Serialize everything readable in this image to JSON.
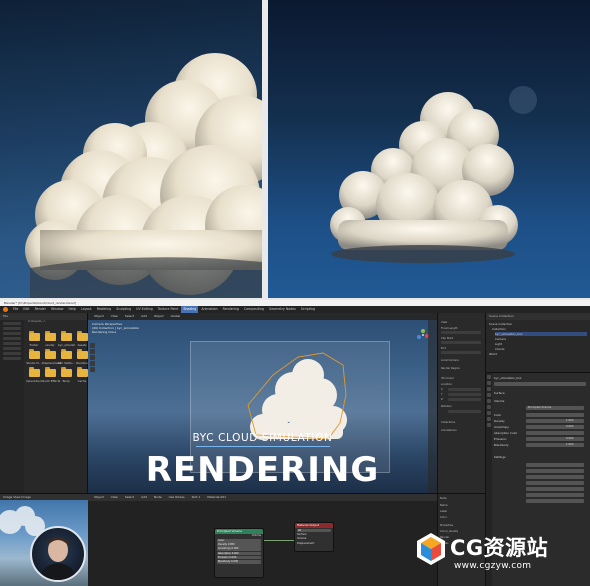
{
  "window": {
    "title": "Blender* [D:\\Projects\\Cloud\\cloud_render.blend]"
  },
  "menubar": {
    "items": [
      "File",
      "Edit",
      "Render",
      "Window",
      "Help",
      "Layout",
      "Modeling",
      "Sculpting",
      "UV Editing",
      "Texture Paint",
      "Shading",
      "Animation",
      "Rendering",
      "Compositing",
      "Geometry Nodes",
      "Scripting"
    ],
    "active": "Shading"
  },
  "file_browser": {
    "header": "File",
    "path": "C:\\Users\\...\\",
    "folders": [
      "Folder",
      "render",
      "byc_simulat",
      "Assets",
      "Studio Cl...",
      "Displacement",
      "Sim Settin...",
      "Renders",
      "OpenCloud",
      "Quick Effects",
      "Temp",
      "Cache"
    ]
  },
  "viewport": {
    "header_items": [
      "Object",
      "View",
      "Select",
      "Add",
      "Object",
      "Global"
    ],
    "info_lines": [
      "Camera Perspective",
      "(40) Collection | byc_simulation",
      "Rendering Done"
    ],
    "overlay_title": "BYC CLOUD SIMULATION",
    "overlay_big": "RENDERING"
  },
  "props_mid": {
    "labels": [
      "View",
      "Focal Length",
      "Clip Start",
      "End",
      "Local Camera",
      "Render Region",
      "3D Cursor",
      "Location",
      "X",
      "Y",
      "Z",
      "Rotation",
      "Collections",
      "Annotations"
    ]
  },
  "outliner": {
    "header": "Scene Collection",
    "items": [
      "Scene Collection",
      "Collection",
      "byc_simulation_box",
      "Camera",
      "Light",
      "Clouds",
      "World"
    ],
    "selected": "byc_simulation_box"
  },
  "properties": {
    "sections": [
      "byc_simulation_box",
      "Surface",
      "Volume",
      "Principled Volume",
      "Color",
      "Density",
      "Anisotropy",
      "Absorption Color",
      "Emission",
      "Blackbody",
      "Settings"
    ],
    "values": [
      "Principled Volume",
      "1.000",
      "0.000",
      "0.000",
      "1.000"
    ]
  },
  "shader_editor": {
    "header_items": [
      "Object",
      "View",
      "Select",
      "Add",
      "Node",
      "Use Nodes",
      "Slot 1",
      "Material.001"
    ],
    "nodes": {
      "volume": {
        "title": "Principled Volume",
        "fields": [
          "Volume",
          "Color",
          "Density 0.850",
          "Anisotropy 0.000",
          "Absorption 0.000",
          "Emission 0.000",
          "Blackbody 0.000",
          "Temperature 1000"
        ]
      },
      "output": {
        "title": "Material Output",
        "rows": [
          "All",
          "Surface",
          "Volume",
          "Displacement"
        ]
      }
    }
  },
  "shader_n_panel": {
    "labels": [
      "Node",
      "Name",
      "Label",
      "Color",
      "Properties",
      "Cloud_density",
      "Render",
      "Cycles"
    ]
  },
  "render_preview": {
    "header": "Image  View  Image"
  },
  "watermark": {
    "text": "CG资源站",
    "url": "www.cgzyw.com"
  },
  "colors": {
    "accent": "#4772b3",
    "blender_orange": "#e87d0d",
    "folder": "#e7b43e",
    "node_volume": "#2f8159",
    "node_output": "#8a2a2a",
    "overlay_line": "#78b6f0"
  }
}
